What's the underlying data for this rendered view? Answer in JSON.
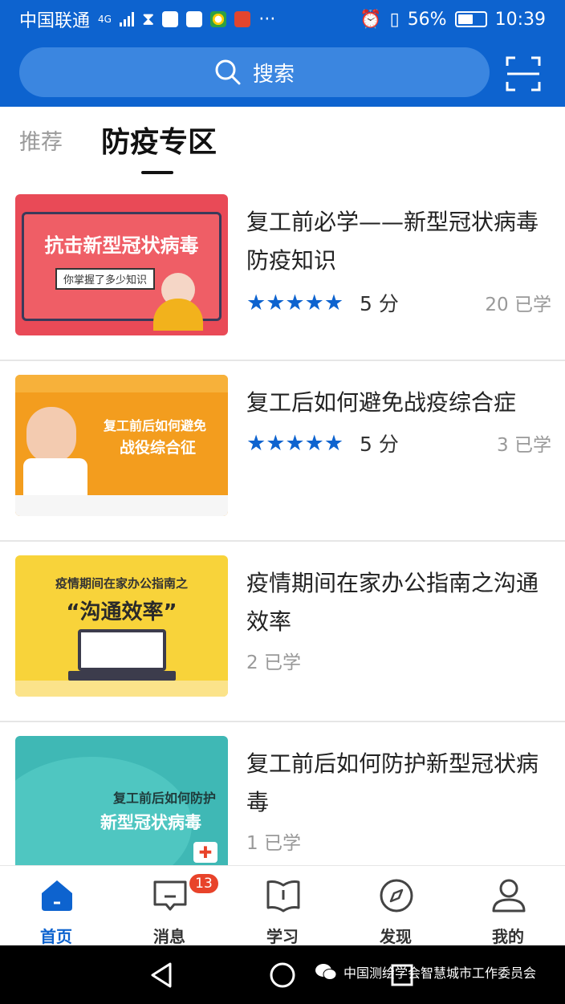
{
  "status_bar": {
    "carrier": "中国联通",
    "network": "4G",
    "battery_percent": "56%",
    "time": "10:39"
  },
  "search": {
    "label": "搜索"
  },
  "tabs": [
    {
      "label": "推荐",
      "active": false
    },
    {
      "label": "防疫专区",
      "active": true
    }
  ],
  "courses": [
    {
      "title": "复工前必学——新型冠状病毒防疫知识",
      "stars": 5,
      "score": "5 分",
      "learned": "20 已学",
      "thumb_text": [
        "抗击新型冠状病毒",
        "你掌握了多少知识"
      ]
    },
    {
      "title": "复工后如何避免战疫综合症",
      "stars": 5,
      "score": "5 分",
      "learned": "3 已学",
      "thumb_text": [
        "复工前后如何避免",
        "战役综合征"
      ]
    },
    {
      "title": "疫情期间在家办公指南之沟通效率",
      "learned": "2 已学",
      "thumb_text": [
        "疫情期间在家办公指南之",
        "“沟通效率”"
      ]
    },
    {
      "title": "复工前后如何防护新型冠状病毒",
      "learned": "1 已学",
      "thumb_text": [
        "复工前后如何防护",
        "新型冠状病毒"
      ]
    }
  ],
  "nav": [
    {
      "label": "首页",
      "active": true
    },
    {
      "label": "消息",
      "badge": "13"
    },
    {
      "label": "学习"
    },
    {
      "label": "发现"
    },
    {
      "label": "我的"
    }
  ],
  "watermark": "中国测绘学会智慧城市工作委员会",
  "colors": {
    "primary": "#0d63cf",
    "badge": "#e8432a"
  }
}
